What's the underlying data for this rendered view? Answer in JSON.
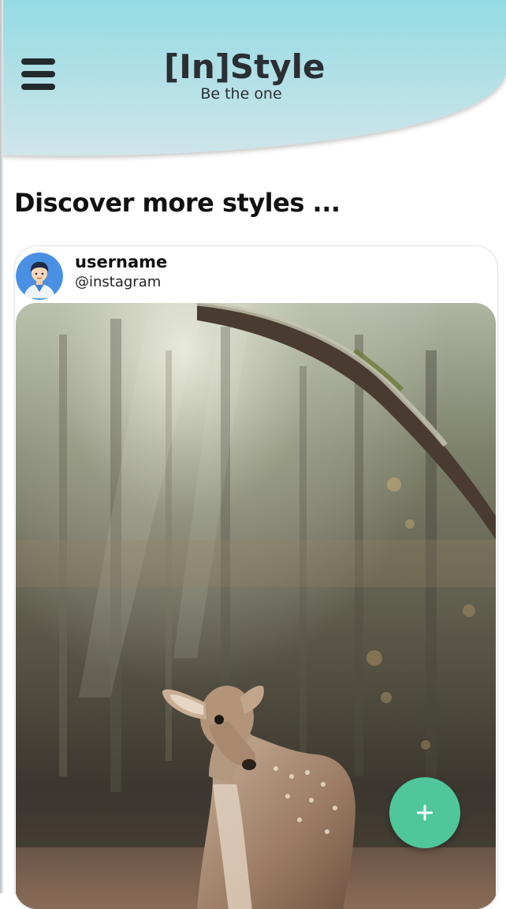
{
  "header": {
    "brand_title": "[In]Style",
    "tagline": "Be the one",
    "menu_icon": "hamburger-menu-icon",
    "gradient_colors": [
      "#95d9e3",
      "#c9e4e8"
    ]
  },
  "discover": {
    "title": "Discover more styles ..."
  },
  "post": {
    "username": "username",
    "handle": "@instagram",
    "avatar_icon": "user-avatar-icon",
    "image_subject": "young deer in a sunlit forest"
  },
  "fab": {
    "label": "+",
    "icon": "plus-icon",
    "color": "#4fc79b"
  }
}
